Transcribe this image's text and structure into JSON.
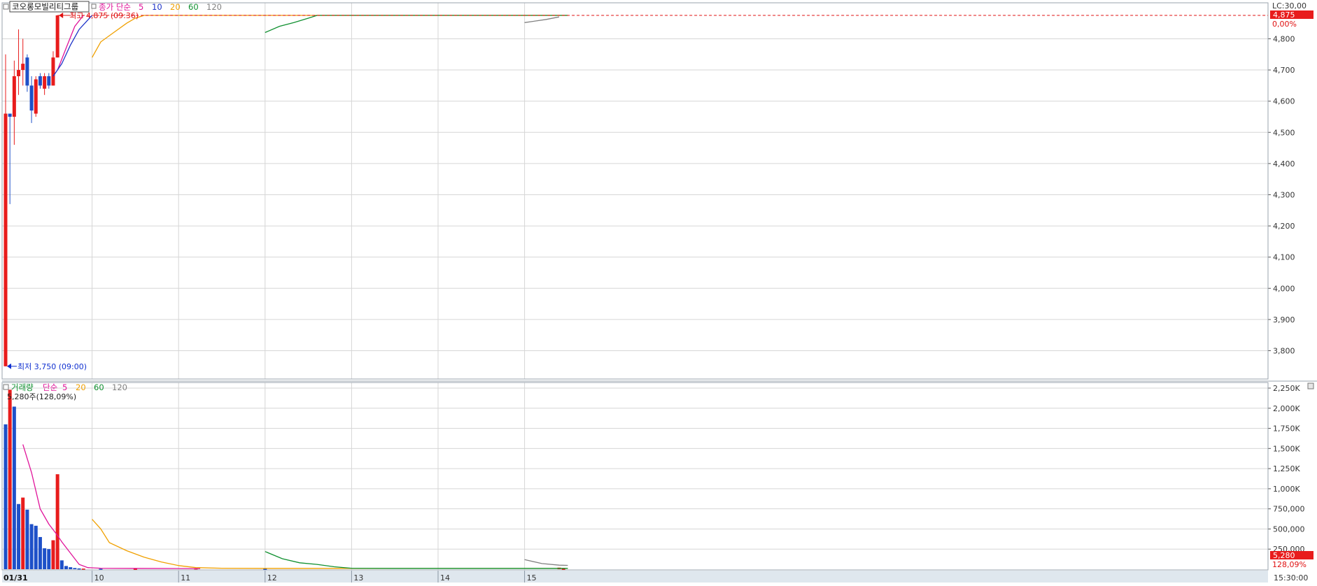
{
  "instrument": "코오롱모빌리티그룹",
  "price_legend": {
    "label": "종가 단순",
    "periods": [
      "5",
      "10",
      "20",
      "60",
      "120"
    ],
    "colors": [
      "#e0149a",
      "#1c32c8",
      "#f0a000",
      "#109030",
      "#808080"
    ]
  },
  "volume_legend": {
    "label": "거래량 단순",
    "periods": [
      "5",
      "20",
      "60",
      "120"
    ],
    "colors": [
      "#e0149a",
      "#f0a000",
      "#109030",
      "#808080"
    ]
  },
  "markers": {
    "high": {
      "text": "최고 4,875 (09:36)",
      "color": "#e01010"
    },
    "low": {
      "text": "최저 3,750 (09:00)",
      "color": "#1030d0"
    }
  },
  "price_tags": {
    "lc": "LC:30,00",
    "last": "4,875",
    "pct": "0,00%"
  },
  "volume_tags": {
    "info": "5,280주(128,09%)",
    "last": "5,280",
    "pct": "128,09%"
  },
  "time_labels": {
    "date": "01/31",
    "end": "15:30:00"
  },
  "colors": {
    "up": "#e81c1c",
    "down": "#1e50c8",
    "grid": "#d6d6d6",
    "axis_bg": "#dfe7ee"
  },
  "chart_data": [
    {
      "type": "candlestick",
      "title": "코오롱모빌리티그룹",
      "x_unit": "minute",
      "x_range": [
        "09:00",
        "15:30"
      ],
      "x_ticks": [
        "10",
        "11",
        "12",
        "13",
        "14",
        "15"
      ],
      "ylim": [
        3725,
        4900
      ],
      "y_ticks": [
        "4,800",
        "4,700",
        "4,600",
        "4,500",
        "4,400",
        "4,300",
        "4,200",
        "4,100",
        "4,000",
        "3,900",
        "3,800"
      ],
      "candles": [
        {
          "t": "09:00",
          "o": 3750,
          "h": 4750,
          "l": 3750,
          "c": 4560
        },
        {
          "t": "09:03",
          "o": 4560,
          "h": 4560,
          "l": 4270,
          "c": 4550
        },
        {
          "t": "09:06",
          "o": 4550,
          "h": 4730,
          "l": 4460,
          "c": 4680
        },
        {
          "t": "09:09",
          "o": 4680,
          "h": 4830,
          "l": 4620,
          "c": 4700
        },
        {
          "t": "09:12",
          "o": 4700,
          "h": 4800,
          "l": 4650,
          "c": 4720
        },
        {
          "t": "09:15",
          "o": 4740,
          "h": 4750,
          "l": 4630,
          "c": 4650
        },
        {
          "t": "09:18",
          "o": 4650,
          "h": 4680,
          "l": 4530,
          "c": 4570
        },
        {
          "t": "09:21",
          "o": 4560,
          "h": 4680,
          "l": 4550,
          "c": 4670
        },
        {
          "t": "09:24",
          "o": 4680,
          "h": 4690,
          "l": 4640,
          "c": 4650
        },
        {
          "t": "09:27",
          "o": 4640,
          "h": 4690,
          "l": 4620,
          "c": 4680
        },
        {
          "t": "09:30",
          "o": 4680,
          "h": 4690,
          "l": 4640,
          "c": 4650
        },
        {
          "t": "09:33",
          "o": 4650,
          "h": 4760,
          "l": 4650,
          "c": 4740
        },
        {
          "t": "09:36",
          "o": 4740,
          "h": 4875,
          "l": 4740,
          "c": 4875
        }
      ],
      "ma_series": [
        {
          "name": "5",
          "points": [
            [
              "09:36",
              4700
            ],
            [
              "09:42",
              4770
            ],
            [
              "09:48",
              4840
            ],
            [
              "09:54",
              4875
            ]
          ]
        },
        {
          "name": "10",
          "points": [
            [
              "09:33",
              4680
            ],
            [
              "09:39",
              4720
            ],
            [
              "09:45",
              4780
            ],
            [
              "09:51",
              4830
            ],
            [
              "09:57",
              4860
            ],
            [
              "10:00",
              4875
            ]
          ]
        },
        {
          "name": "20",
          "points": [
            [
              "10:00",
              4740
            ],
            [
              "10:06",
              4790
            ],
            [
              "10:15",
              4820
            ],
            [
              "10:24",
              4850
            ],
            [
              "10:30",
              4866
            ],
            [
              "10:36",
              4875
            ],
            [
              "15:30",
              4875
            ]
          ]
        },
        {
          "name": "60",
          "points": [
            [
              "12:00",
              4820
            ],
            [
              "12:10",
              4840
            ],
            [
              "12:20",
              4852
            ],
            [
              "12:30",
              4866
            ],
            [
              "12:36",
              4875
            ],
            [
              "15:30",
              4875
            ]
          ]
        },
        {
          "name": "120",
          "points": [
            [
              "15:00",
              4852
            ],
            [
              "15:15",
              4862
            ],
            [
              "15:24",
              4870
            ]
          ]
        }
      ]
    },
    {
      "type": "bar",
      "title": "거래량",
      "x_unit": "minute",
      "ylim": [
        0,
        2300
      ],
      "y_unit": "K",
      "y_ticks": [
        "2,250K",
        "2,000K",
        "1,750K",
        "1,500K",
        "1,250K",
        "1,000K",
        "750,000",
        "500,000",
        "250,000"
      ],
      "bars": [
        {
          "t": "09:00",
          "v": 1800,
          "dir": "down"
        },
        {
          "t": "09:03",
          "v": 2230,
          "dir": "up"
        },
        {
          "t": "09:06",
          "v": 2020,
          "dir": "down"
        },
        {
          "t": "09:09",
          "v": 810,
          "dir": "down"
        },
        {
          "t": "09:12",
          "v": 890,
          "dir": "up"
        },
        {
          "t": "09:15",
          "v": 740,
          "dir": "down"
        },
        {
          "t": "09:18",
          "v": 560,
          "dir": "down"
        },
        {
          "t": "09:21",
          "v": 540,
          "dir": "down"
        },
        {
          "t": "09:24",
          "v": 400,
          "dir": "down"
        },
        {
          "t": "09:27",
          "v": 260,
          "dir": "down"
        },
        {
          "t": "09:30",
          "v": 250,
          "dir": "down"
        },
        {
          "t": "09:33",
          "v": 360,
          "dir": "up"
        },
        {
          "t": "09:36",
          "v": 1180,
          "dir": "up"
        },
        {
          "t": "09:39",
          "v": 110,
          "dir": "down"
        },
        {
          "t": "09:42",
          "v": 40,
          "dir": "down"
        },
        {
          "t": "09:45",
          "v": 25,
          "dir": "down"
        },
        {
          "t": "09:48",
          "v": 15,
          "dir": "down"
        },
        {
          "t": "09:51",
          "v": 10,
          "dir": "down"
        },
        {
          "t": "09:54",
          "v": 8,
          "dir": "up"
        },
        {
          "t": "10:06",
          "v": 6,
          "dir": "down"
        },
        {
          "t": "10:30",
          "v": 5,
          "dir": "up"
        },
        {
          "t": "11:12",
          "v": 10,
          "dir": "up"
        },
        {
          "t": "12:00",
          "v": 4,
          "dir": "down"
        },
        {
          "t": "15:24",
          "v": 20,
          "dir": "up"
        },
        {
          "t": "15:27",
          "v": 5,
          "dir": "up"
        }
      ],
      "ma_series": [
        {
          "name": "5",
          "points": [
            [
              "09:12",
              1550
            ],
            [
              "09:18",
              1200
            ],
            [
              "09:24",
              750
            ],
            [
              "09:30",
              560
            ],
            [
              "09:36",
              420
            ],
            [
              "09:39",
              340
            ],
            [
              "09:45",
              200
            ],
            [
              "09:51",
              60
            ],
            [
              "09:57",
              20
            ],
            [
              "10:06",
              12
            ],
            [
              "10:30",
              10
            ],
            [
              "11:00",
              9
            ],
            [
              "11:15",
              8
            ]
          ]
        },
        {
          "name": "20",
          "points": [
            [
              "10:00",
              620
            ],
            [
              "10:06",
              500
            ],
            [
              "10:12",
              330
            ],
            [
              "10:24",
              230
            ],
            [
              "10:36",
              150
            ],
            [
              "10:48",
              90
            ],
            [
              "11:00",
              45
            ],
            [
              "11:12",
              20
            ],
            [
              "11:30",
              12
            ],
            [
              "12:00",
              10
            ],
            [
              "15:30",
              10
            ]
          ]
        },
        {
          "name": "60",
          "points": [
            [
              "12:00",
              220
            ],
            [
              "12:12",
              130
            ],
            [
              "12:24",
              80
            ],
            [
              "12:36",
              60
            ],
            [
              "12:48",
              30
            ],
            [
              "13:00",
              12
            ],
            [
              "13:30",
              10
            ],
            [
              "15:30",
              10
            ]
          ]
        },
        {
          "name": "120",
          "points": [
            [
              "15:00",
              120
            ],
            [
              "15:12",
              70
            ],
            [
              "15:24",
              50
            ],
            [
              "15:30",
              48
            ]
          ]
        }
      ]
    }
  ]
}
